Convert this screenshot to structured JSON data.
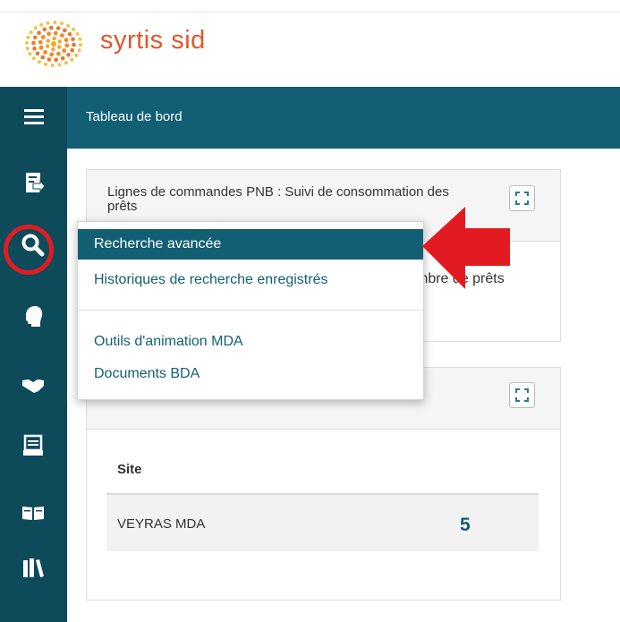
{
  "brand": {
    "name": "syrtis sid",
    "color": "#e0572c"
  },
  "header": {
    "title": "Tableau de bord",
    "bg_color": "#125f74",
    "menu_icon": "hamburger-icon"
  },
  "sidebar": {
    "bg_color": "#0d4a5a",
    "icons": [
      "dashboard-icon",
      "search-icon",
      "head-icon",
      "handshake-icon",
      "drawer-icon",
      "open-book-icon",
      "books-icon"
    ]
  },
  "cards": [
    {
      "title": "Lignes de commandes PNB : Suivi de consommation des prêts",
      "partial_text": "mbre de prêts"
    },
    {
      "table": {
        "header": "Site",
        "rows": [
          {
            "site": "VEYRAS MDA",
            "count": "5"
          }
        ]
      }
    }
  ],
  "dropdown": {
    "items": [
      {
        "label": "Recherche avancée",
        "active": true
      },
      {
        "label": "Historiques de recherche enregistrés",
        "active": false
      },
      {
        "label": "Outils d'animation MDA",
        "active": false
      },
      {
        "label": "Documents BDA",
        "active": false
      }
    ]
  },
  "annotation": {
    "color": "#e21b23"
  }
}
